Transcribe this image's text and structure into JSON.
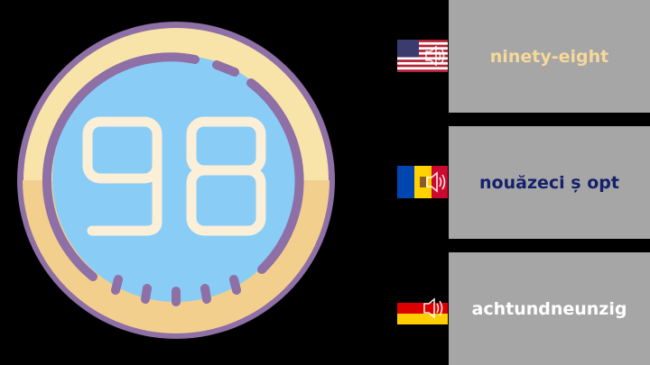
{
  "badge": {
    "number": "98"
  },
  "rows": [
    {
      "flag": "us-flag-speaker-icon",
      "label": "ninety-eight",
      "color": "#f6d99a",
      "language": "English"
    },
    {
      "flag": "moldova-flag-speaker-icon",
      "label": "nouăzeci ș opt",
      "color": "#15216b",
      "language": "Romanian"
    },
    {
      "flag": "germany-flag-speaker-icon",
      "label": "achtundneunzig",
      "color": "#ffffff",
      "language": "German"
    }
  ],
  "colors": {
    "background": "#000000",
    "panel": "#a6a6a6",
    "ring": "#8e6fa6",
    "cream": "#f8e4a8",
    "face": "#89cdf6",
    "digits": "#fbefd8"
  }
}
